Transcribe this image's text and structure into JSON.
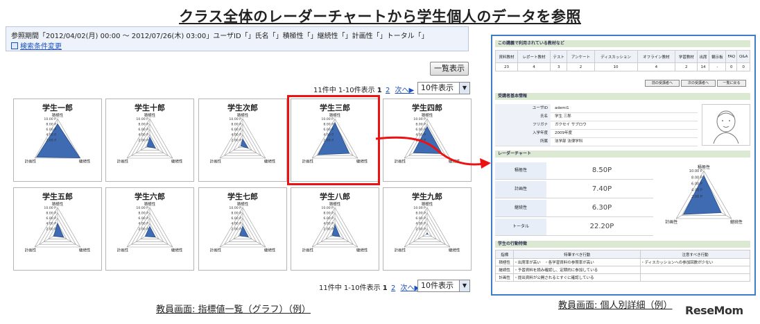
{
  "page_title": "クラス全体のレーダーチャートから学生個人のデータを参照",
  "query": {
    "text": "参照期間「2012/04/02(月) 00:00 〜 2012/07/26(木) 03:00」ユーザID「」氏名「」積極性「」継続性「」計画性「」トータル「」",
    "search_link": "検索条件変更"
  },
  "list_button": "一覧表示",
  "pager_top": {
    "summary": "11件中 1-10件表示",
    "current": "1",
    "page2": "2",
    "next": "次へ▶",
    "per_page": "10件表示"
  },
  "pager_bottom": {
    "summary": "11件中 1-10件表示",
    "current": "1",
    "page2": "2",
    "next": "次へ▶",
    "per_page": "10件表示"
  },
  "radar_common": {
    "max": 10,
    "scale_labels": [
      "10.00 P",
      "8.00 P",
      "6.00 P",
      "4.00 P",
      "2.00 P"
    ],
    "axes": [
      "積極性",
      "継続性",
      "計画性"
    ]
  },
  "students": [
    {
      "name": "学生一郎",
      "values": [
        8.0,
        9.8,
        9.2
      ]
    },
    {
      "name": "学生十郎",
      "values": [
        3.0,
        2.5,
        1.2
      ]
    },
    {
      "name": "学生次郎",
      "values": [
        2.3,
        2.4,
        0.8
      ]
    },
    {
      "name": "学生三郎",
      "values": [
        8.5,
        6.3,
        7.4
      ]
    },
    {
      "name": "学生四郎",
      "values": [
        7.0,
        6.5,
        6.0
      ]
    },
    {
      "name": "学生五郎",
      "values": [
        4.0,
        2.7,
        1.7
      ]
    },
    {
      "name": "学生六郎",
      "values": [
        2.8,
        2.5,
        2.0
      ]
    },
    {
      "name": "学生七郎",
      "values": [
        2.9,
        2.5,
        1.3
      ]
    },
    {
      "name": "学生八郎",
      "values": [
        3.4,
        2.2,
        1.2
      ]
    },
    {
      "name": "学生九郎",
      "values": [
        0.3,
        0.3,
        0.3
      ]
    }
  ],
  "captions": {
    "left": "教員画面: 指標値一覧（グラフ）（例）",
    "right": "教員画面: 個人別詳細（例）"
  },
  "detail": {
    "usage_title": "この講義で利用されている教材など",
    "usage_headers": [
      "資料教材",
      "レポート教材",
      "テスト",
      "アンケート",
      "ディスカッション",
      "オフライン教材",
      "学習教材",
      "出席",
      "観示板",
      "FAQ",
      "Q&A"
    ],
    "usage_values": [
      "23",
      "4",
      "3",
      "2",
      "10",
      "4",
      "2",
      "14",
      "-",
      "0",
      "0"
    ],
    "nav_buttons": [
      "前の受講者へ",
      "次の受講者へ",
      "一覧に戻る"
    ],
    "info_title": "受講者基本情報",
    "info_rows": [
      {
        "label": "ユーザID",
        "value": "ademi1"
      },
      {
        "label": "氏名",
        "value": "学生 三郎"
      },
      {
        "label": "フリガナ",
        "value": "ガクセイ サブロウ"
      },
      {
        "label": "入学年度",
        "value": "2009年度"
      },
      {
        "label": "所属",
        "value": "法学部 法律学科"
      }
    ],
    "radar_title": "レーダーチャート",
    "radar_rows": [
      {
        "label": "積極性",
        "value": "8.50P"
      },
      {
        "label": "計画性",
        "value": "7.40P"
      },
      {
        "label": "継続性",
        "value": "6.30P"
      },
      {
        "label": "トータル",
        "value": "22.20P"
      }
    ],
    "radar_values": [
      8.5,
      6.3,
      7.4
    ],
    "behavior_title": "学生の行動特徴",
    "behavior_headers": [
      "指標",
      "特筆すべき行動",
      "注意すべき行動"
    ],
    "behavior_rows": [
      {
        "label": "積極性",
        "good": "・出席率が高い　・各学習資料の参照率が高い",
        "caution": "・ディスカッションへの参加回数が少ない"
      },
      {
        "label": "継続性",
        "good": "・予習資料を読み確認し、定期的に参加している",
        "caution": ""
      },
      {
        "label": "計画性",
        "good": "・提出資料が公開されるとすぐに確認している",
        "caution": ""
      }
    ]
  },
  "watermark": "ReseMom",
  "colors": {
    "radar_fill": "#3f6bb3",
    "highlight": "#ee1111",
    "arrow": "#ee1111",
    "detail_border": "#3d7cc9"
  }
}
